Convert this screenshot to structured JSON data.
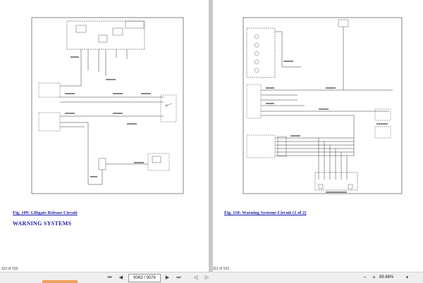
{
  "left_page": {
    "figure_caption": "Fig. 109: Liftgate Release Circuit",
    "section_heading": "WARNING SYSTEMS",
    "page_label": "110 of 153"
  },
  "right_page": {
    "figure_caption": "Fig. 110: Warning Systems Circuit (1 of 2)",
    "page_label": "111 of 153"
  },
  "toolbar": {
    "page_value": "9063 / 9076",
    "zoom_value": "89.68%",
    "icons": [
      "first-page-icon",
      "prev-page-icon",
      "next-page-icon",
      "last-page-icon",
      "prev-view-icon",
      "next-view-icon",
      "zoom-out-icon",
      "zoom-in-icon",
      "zoom-dropdown-icon"
    ]
  },
  "colors": {
    "caption": "#1a1aa8",
    "gutter": "#c9c9c9",
    "toolbar": "#efefef",
    "accent": "#f0a060"
  }
}
